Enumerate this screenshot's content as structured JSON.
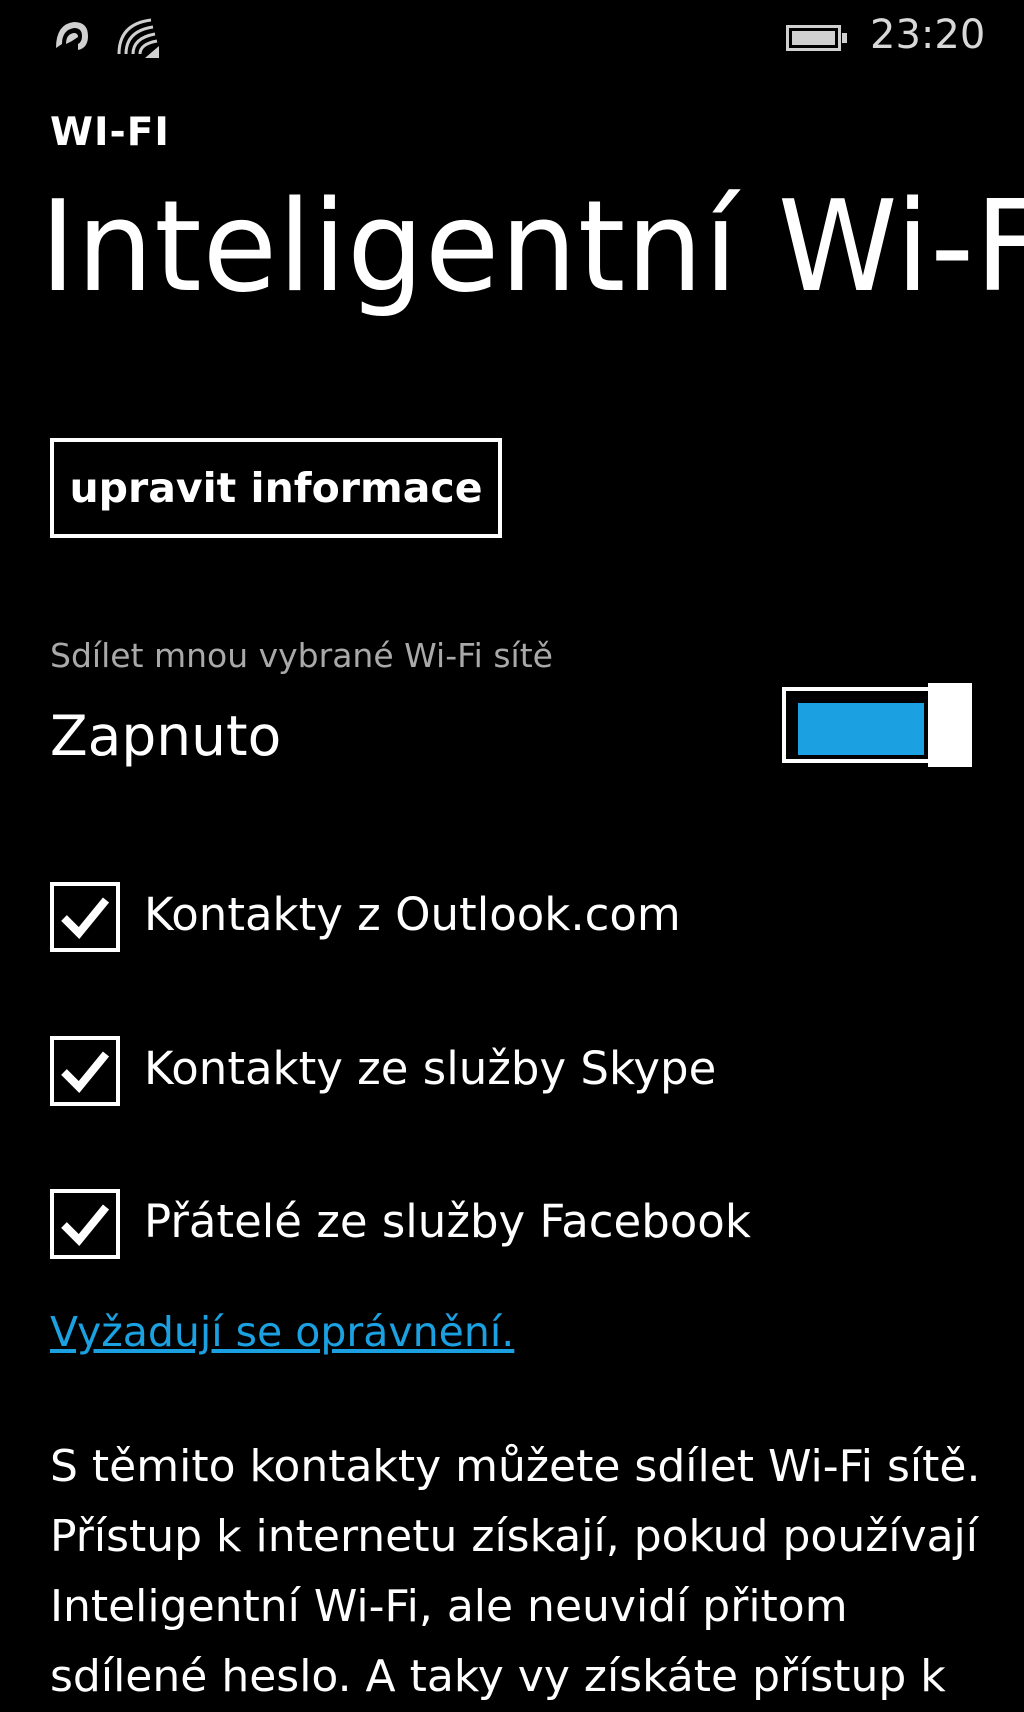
{
  "status_bar": {
    "signal_icon": "cellular-signal-icon",
    "wifi_icon": "wifi-icon",
    "battery_icon": "battery-icon",
    "time": "23:20"
  },
  "header": {
    "app_title": "WI-FI",
    "page_title": "Inteligentní Wi-Fi"
  },
  "edit_button_label": "upravit informace",
  "sharing": {
    "label": "Sdílet mnou vybrané Wi-Fi sítě",
    "state": "Zapnuto",
    "toggle_on": true,
    "accent_color": "#1ba1e2"
  },
  "contacts": [
    {
      "label": "Kontakty z Outlook.com",
      "checked": true
    },
    {
      "label": "Kontakty ze služby Skype",
      "checked": true
    },
    {
      "label": "Přátelé ze služby Facebook",
      "checked": true
    }
  ],
  "permissions_link": "Vyžadují se oprávnění.",
  "description": "S těmito kontakty můžete sdílet Wi-Fi sítě. Přístup k internetu získají, pokud používají Inteligentní Wi-Fi, ale neuvidí přitom sdílené heslo. A taky vy získáte přístup k"
}
